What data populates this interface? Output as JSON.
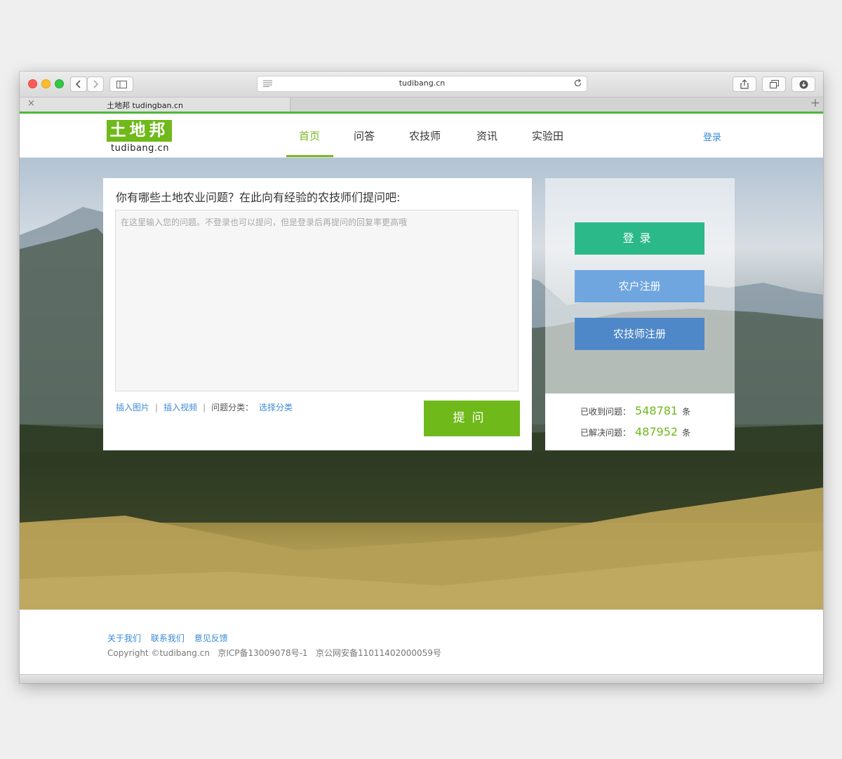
{
  "browser": {
    "url": "tudibang.cn",
    "tab_title": "土地邦 tudingban.cn"
  },
  "site": {
    "logo_text": "土地邦",
    "logo_sub": "tudibang.cn",
    "nav": [
      "首页",
      "问答",
      "农技师",
      "资讯",
      "实验田"
    ],
    "login_link": "登录",
    "accent": "#6fb91a"
  },
  "question": {
    "title": "你有哪些土地农业问题？在此向有经验的农技师们提问吧:",
    "placeholder": "在这里输入您的问题。不登录也可以提问，但是登录后再提问的回复率更高哦",
    "insert_image": "插入图片",
    "insert_video": "插入视频",
    "category_label": "问题分类：",
    "choose_category": "选择分类",
    "ask_button": "提问"
  },
  "side": {
    "login_button": "登录",
    "farmer_register": "农户注册",
    "tech_register": "农技师注册",
    "received_label": "已收到问题：",
    "received_count": "548781",
    "solved_label": "已解决问题：",
    "solved_count": "487952",
    "unit": "条"
  },
  "footer": {
    "links": [
      "关于我们",
      "联系我们",
      "意见反馈"
    ],
    "copyright": "Copyright ©tudibang.cn   京ICP备13009078号-1   京公网安备11011402000059号"
  }
}
